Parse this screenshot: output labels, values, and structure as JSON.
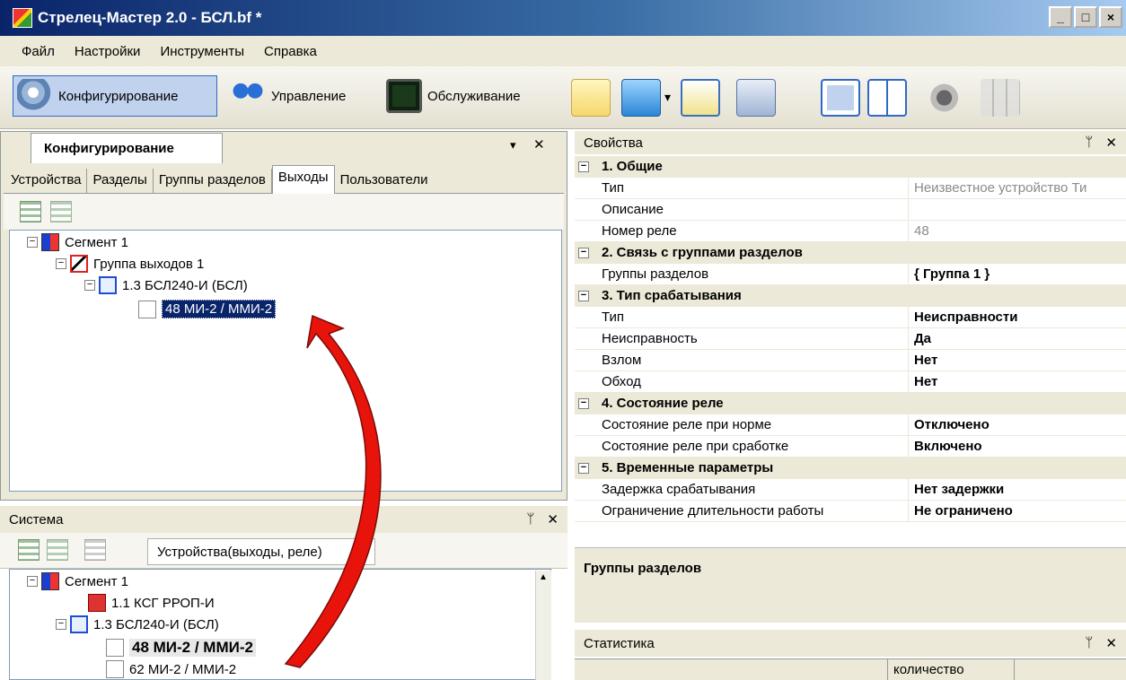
{
  "window": {
    "title": "Стрелец-Мастер 2.0 - БСЛ.bf *",
    "minimize": "_",
    "maximize": "□",
    "close": "×"
  },
  "menu": [
    "Файл",
    "Настройки",
    "Инструменты",
    "Справка"
  ],
  "toolbar": {
    "modes": [
      "Конфигурирование",
      "Управление",
      "Обслуживание"
    ]
  },
  "config_panel": {
    "tab_title": "Конфигурирование",
    "tabs": [
      "Устройства",
      "Разделы",
      "Группы разделов",
      "Выходы",
      "Пользователи"
    ],
    "tree": [
      {
        "label": "Сегмент 1"
      },
      {
        "label": "Группа выходов 1"
      },
      {
        "label": "1.3 БСЛ240-И (БСЛ)"
      },
      {
        "label": "48 МИ-2 / ММИ-2"
      }
    ]
  },
  "system_panel": {
    "title": "Система",
    "filter": "Устройства(выходы, реле)",
    "tree": [
      {
        "label": "Сегмент 1"
      },
      {
        "label": "1.1 КСГ РРОП-И"
      },
      {
        "label": "1.3 БСЛ240-И (БСЛ)"
      },
      {
        "label": "48 МИ-2 / ММИ-2"
      },
      {
        "label": "62 МИ-2 / ММИ-2"
      }
    ]
  },
  "properties": {
    "title": "Свойства",
    "rows": [
      {
        "cat": true,
        "k": "1. Общие",
        "v": ""
      },
      {
        "k": "Тип",
        "v": "Неизвестное устройство Ти",
        "gray": true
      },
      {
        "k": "Описание",
        "v": ""
      },
      {
        "k": "Номер реле",
        "v": "48",
        "gray": true
      },
      {
        "cat": true,
        "k": "2. Связь с группами разделов",
        "v": ""
      },
      {
        "k": "Группы разделов",
        "v": "{ Группа 1 }"
      },
      {
        "cat": true,
        "k": "3. Тип срабатывания",
        "v": ""
      },
      {
        "k": "Тип",
        "v": "Неисправности"
      },
      {
        "k": "Неисправность",
        "v": "Да"
      },
      {
        "k": "Взлом",
        "v": "Нет"
      },
      {
        "k": "Обход",
        "v": "Нет"
      },
      {
        "cat": true,
        "k": "4. Состояние реле",
        "v": ""
      },
      {
        "k": "Состояние реле при норме",
        "v": "Отключено"
      },
      {
        "k": "Состояние реле при сработке",
        "v": "Включено"
      },
      {
        "cat": true,
        "k": "5. Временные параметры",
        "v": ""
      },
      {
        "k": "Задержка срабатывания",
        "v": "Нет задержки"
      },
      {
        "k": "Ограничение длительности работы",
        "v": "Не ограничено"
      }
    ],
    "description_title": "Группы разделов"
  },
  "statistics": {
    "title": "Статистика",
    "column": "количество"
  },
  "glyphs": {
    "minus": "−",
    "close": "✕",
    "pin": "ᛘ",
    "dropdown": "▾",
    "scroll_up": "▲"
  },
  "icons": [
    "settings-icon",
    "control-icon",
    "monitor-icon",
    "new-file-icon",
    "open-folder-icon",
    "save-icon",
    "run-icon",
    "layout-single-icon",
    "layout-split-icon",
    "sound-icon",
    "grid-icon",
    "segment-icon",
    "output-group-icon",
    "device-icon",
    "output-icon"
  ],
  "colors": {
    "title_start": "#0a246a",
    "title_end": "#a6caf0",
    "selection": "#0a246a",
    "arrow": "#e8140c"
  }
}
